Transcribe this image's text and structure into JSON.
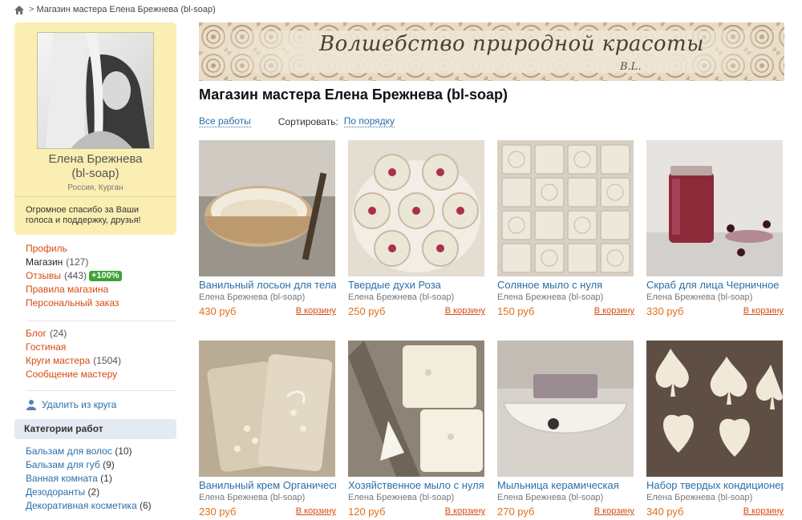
{
  "breadcrumb": {
    "separator": ">",
    "current": "Магазин мастера Елена Брежнева (bl-soap)"
  },
  "profile": {
    "name": "Елена Брежнева",
    "nick": "(bl-soap)",
    "location": "Россия, Курган",
    "status": "Огромное спасибо за Ваши голоса и поддержку, друзья!"
  },
  "menu1": [
    {
      "label": "Профиль",
      "count": "",
      "badge": ""
    },
    {
      "label": "Магазин",
      "count": "(127)",
      "badge": ""
    },
    {
      "label": "Отзывы",
      "count": "(443)",
      "badge": "+100%"
    },
    {
      "label": "Правила магазина",
      "count": "",
      "badge": ""
    },
    {
      "label": "Персональный заказ",
      "count": "",
      "badge": ""
    }
  ],
  "menu2": [
    {
      "label": "Блог",
      "count": "(24)"
    },
    {
      "label": "Гостиная",
      "count": ""
    },
    {
      "label": "Круги мастера",
      "count": "(1504)"
    },
    {
      "label": "Сообщение мастеру",
      "count": ""
    }
  ],
  "remove_circle": "Удалить из круга",
  "categories": {
    "header": "Категории работ",
    "items": [
      {
        "label": "Бальзам для волос",
        "count": "(10)"
      },
      {
        "label": "Бальзам для губ",
        "count": "(9)"
      },
      {
        "label": "Ванная комната",
        "count": "(1)"
      },
      {
        "label": "Дезодоранты",
        "count": "(2)"
      },
      {
        "label": "Декоративная косметика",
        "count": "(6)"
      }
    ]
  },
  "banner": {
    "text": "Волшебство природной красоты",
    "signature": "B.L."
  },
  "page_title": "Магазин мастера Елена Брежнева (bl-soap)",
  "toolbar": {
    "all_works": "Все работы",
    "sort_label": "Сортировать:",
    "sort_value": "По порядку"
  },
  "products": [
    {
      "title": "Ванильный лосьон для тела",
      "seller": "Елена Брежнева (bl-soap)",
      "price": "430 руб",
      "cart": "В корзину"
    },
    {
      "title": "Твердые духи Роза",
      "seller": "Елена Брежнева (bl-soap)",
      "price": "250 руб",
      "cart": "В корзину"
    },
    {
      "title": "Соляное мыло с нуля",
      "seller": "Елена Брежнева (bl-soap)",
      "price": "150 руб",
      "cart": "В корзину"
    },
    {
      "title": "Скраб для лица Черничное",
      "seller": "Елена Брежнева (bl-soap)",
      "price": "330 руб",
      "cart": "В корзину"
    },
    {
      "title": "Ванильный крем Органический",
      "seller": "Елена Брежнева (bl-soap)",
      "price": "230 руб",
      "cart": "В корзину"
    },
    {
      "title": "Хозяйственное мыло с нуля",
      "seller": "Елена Брежнева (bl-soap)",
      "price": "120 руб",
      "cart": "В корзину"
    },
    {
      "title": "Мыльница керамическая",
      "seller": "Елена Брежнева (bl-soap)",
      "price": "270 руб",
      "cart": "В корзину"
    },
    {
      "title": "Набор твердых кондиционеров",
      "seller": "Елена Брежнева (bl-soap)",
      "price": "340 руб",
      "cart": "В корзину"
    }
  ],
  "colors": {
    "accent_red": "#d64a10",
    "link_blue": "#2a6fa8",
    "price_orange": "#e0701a",
    "profile_bg": "#fbeeb3",
    "badge_green": "#3ca234"
  }
}
